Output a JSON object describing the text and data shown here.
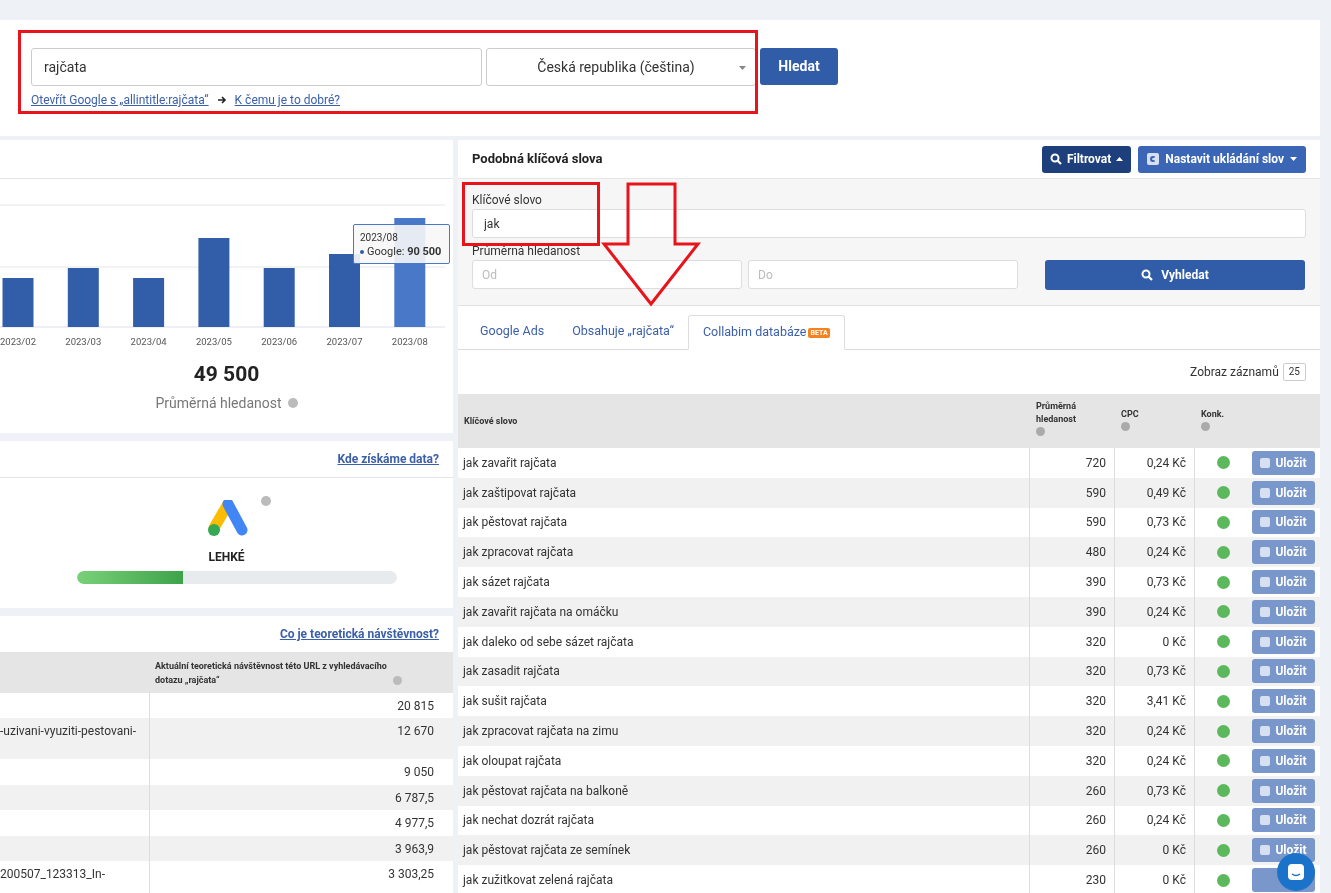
{
  "search": {
    "query": "rajčata",
    "country": "Česká republika (čeština)",
    "button": "Hledat",
    "links": [
      "Otevřít Google s „allintitle:rajčata“",
      "K čemu je to dobré?"
    ]
  },
  "trend": {
    "categories": [
      "2023/02",
      "2023/03",
      "2023/04",
      "2023/05",
      "2023/06",
      "2023/07",
      "2023/08"
    ],
    "tooltip_title": "2023/08",
    "tooltip_label": "Google:",
    "tooltip_value": "90 500",
    "value": "49 500",
    "label": "Průměrná hledanost"
  },
  "difficulty": {
    "link": "Kde získáme data?",
    "label": "LEHKÉ",
    "level": 0.33
  },
  "traffic": {
    "link": "Co je teoretická návštěvnost?",
    "column_2": "Aktuální teoretická návštěvnost této URL z vyhledávacího dotazu „rajčata“",
    "rows": [
      {
        "column_1": "",
        "value": "20 815"
      },
      {
        "column_1": "-uzivani-vyuziti-pestovani-",
        "value": "12 670"
      },
      {
        "column_1": "",
        "value": "9 050"
      },
      {
        "column_1": "",
        "value": "6 787,5"
      },
      {
        "column_1": "",
        "value": "4 977,5"
      },
      {
        "column_1": "",
        "value": "3 963,9"
      },
      {
        "column_1": "200507_123313_In-",
        "value": "3 303,25"
      }
    ]
  },
  "similar": {
    "title": "Podobná klíčová slova",
    "filter_button": "Filtrovat",
    "save_button": "Nastavit ukládání slov",
    "keyword_label": "Klíčové slovo",
    "keyword_value": "jak",
    "volume_label": "Průměrná hledanost",
    "from_placeholder": "Od",
    "to_placeholder": "Do",
    "search_button": "Vyhledat",
    "tabs": [
      {
        "label": "Google Ads",
        "selected": false
      },
      {
        "label": "Obsahuje „rajčata“",
        "selected": false
      },
      {
        "label": "Collabim databáze",
        "badge": "BETA",
        "selected": true
      }
    ],
    "page_size_label": "Zobraz záznamů",
    "page_size": "25",
    "columns": [
      "Klíčové slovo",
      "Průměrná hledanost",
      "CPC",
      "Konk."
    ],
    "rows": [
      {
        "keyword": "jak zavařit rajčata",
        "volume": "720",
        "cpc": "0,24 Kč",
        "color": "#5cb85c",
        "button": "Uložit"
      },
      {
        "keyword": "jak zaštipovat rajčata",
        "volume": "590",
        "cpc": "0,49 Kč",
        "color": "#5cb85c",
        "button": "Uložit"
      },
      {
        "keyword": "jak pěstovat rajčata",
        "volume": "590",
        "cpc": "0,73 Kč",
        "color": "#5cb85c",
        "button": "Uložit"
      },
      {
        "keyword": "jak zpracovat rajčata",
        "volume": "480",
        "cpc": "0,24 Kč",
        "color": "#5cb85c",
        "button": "Uložit"
      },
      {
        "keyword": "jak sázet rajčata",
        "volume": "390",
        "cpc": "0,73 Kč",
        "color": "#5cb85c",
        "button": "Uložit"
      },
      {
        "keyword": "jak zavařit rajčata na omáčku",
        "volume": "390",
        "cpc": "0,24 Kč",
        "color": "#5cb85c",
        "button": "Uložit"
      },
      {
        "keyword": "jak daleko od sebe sázet rajčata",
        "volume": "320",
        "cpc": "0 Kč",
        "color": "#5cb85c",
        "button": "Uložit"
      },
      {
        "keyword": "jak zasadit rajčata",
        "volume": "320",
        "cpc": "0,73 Kč",
        "color": "#5cb85c",
        "button": "Uložit"
      },
      {
        "keyword": "jak sušit rajčata",
        "volume": "320",
        "cpc": "3,41 Kč",
        "color": "#5cb85c",
        "button": "Uložit"
      },
      {
        "keyword": "jak zpracovat rajčata na zimu",
        "volume": "320",
        "cpc": "0,24 Kč",
        "color": "#5cb85c",
        "button": "Uložit"
      },
      {
        "keyword": "jak oloupat rajčata",
        "volume": "320",
        "cpc": "0,24 Kč",
        "color": "#5cb85c",
        "button": "Uložit"
      },
      {
        "keyword": "jak pěstovat rajčata na balkoně",
        "volume": "260",
        "cpc": "0,73 Kč",
        "color": "#5cb85c",
        "button": "Uložit"
      },
      {
        "keyword": "jak nechat dozrát rajčata",
        "volume": "260",
        "cpc": "0,24 Kč",
        "color": "#5cb85c",
        "button": "Uložit"
      },
      {
        "keyword": "jak pěstovat rajčata ze semínek",
        "volume": "260",
        "cpc": "0 Kč",
        "color": "#5cb85c",
        "button": "Uložit"
      },
      {
        "keyword": "jak zužitkovat zelená rajčata",
        "volume": "230",
        "cpc": "0 Kč",
        "color": "#5cb85c"
      }
    ]
  }
}
